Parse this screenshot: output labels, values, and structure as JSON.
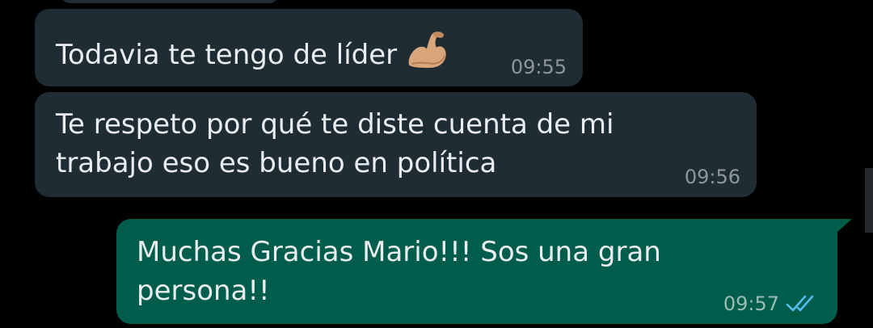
{
  "messages": [
    {
      "direction": "incoming",
      "text": "",
      "time": ""
    },
    {
      "direction": "incoming",
      "text": "Todavia te tengo de líder",
      "emoji": "flexed-biceps",
      "time": "09:55"
    },
    {
      "direction": "incoming",
      "lines": [
        "Te respeto por qué te diste cuenta de mi",
        "trabajo eso es bueno en política"
      ],
      "time": "09:56"
    },
    {
      "direction": "outgoing",
      "lines": [
        "Muchas Gracias Mario!!! Sos una gran",
        "persona!!"
      ],
      "time": "09:57",
      "status": "read",
      "status_icon": "double-check-icon"
    }
  ],
  "colors": {
    "background": "#000000",
    "incoming_bubble": "#1f2c34",
    "outgoing_bubble": "#005c4b",
    "message_text": "#e9edef",
    "timestamp": "#8d969b",
    "read_ticks": "#53bdeb"
  }
}
